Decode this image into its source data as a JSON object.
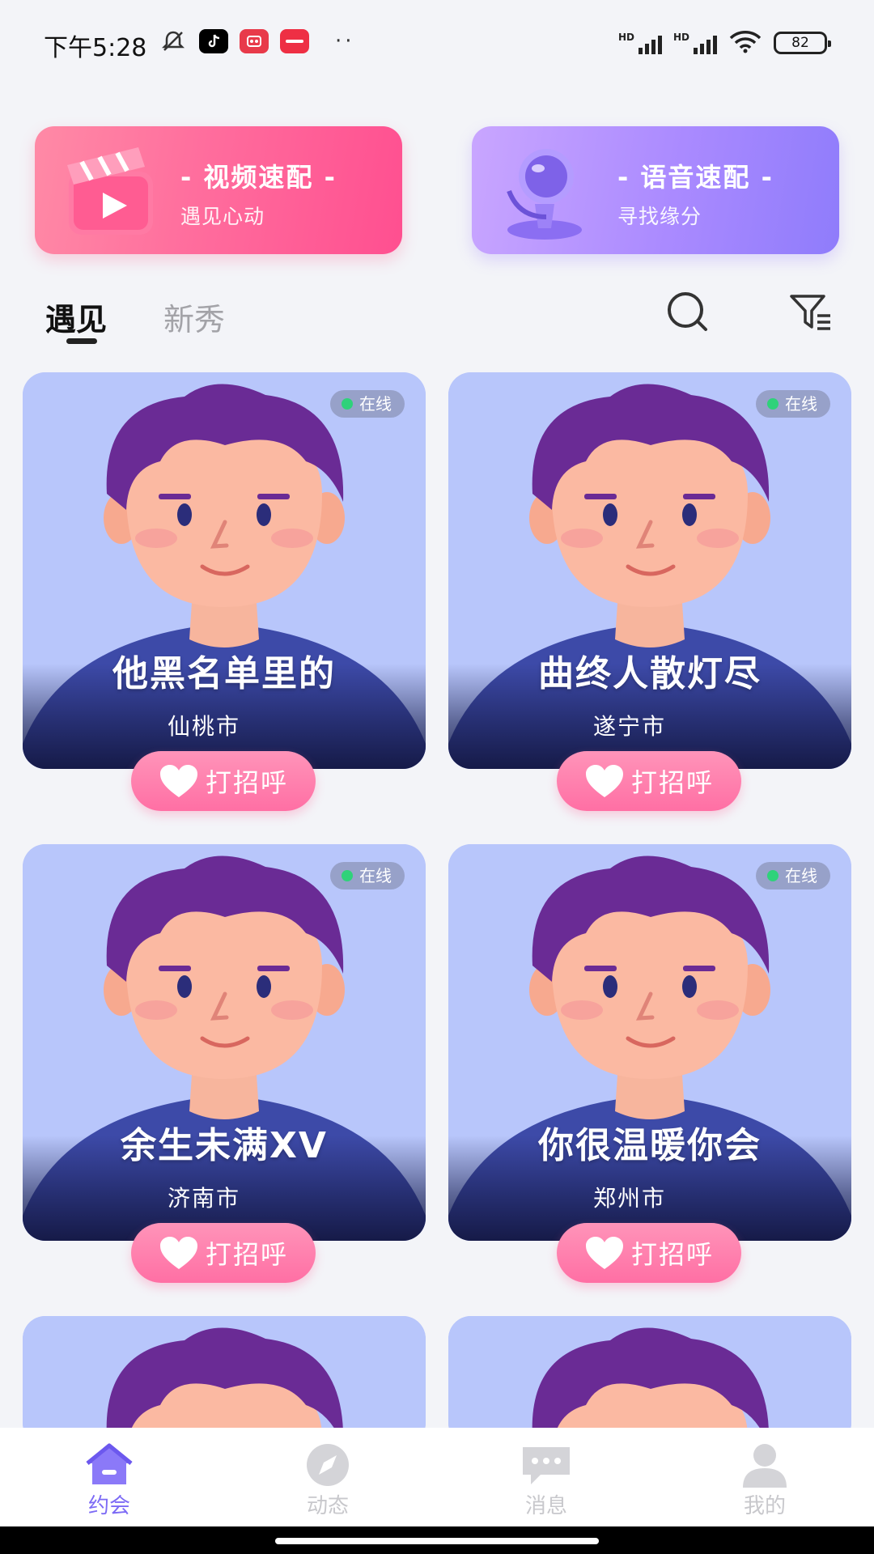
{
  "status_bar": {
    "time": "下午5:28",
    "battery": "82",
    "signal_label_1": "HD",
    "signal_label_2": "HD",
    "more_dots": "··"
  },
  "banners": {
    "video": {
      "title": "- 视频速配 -",
      "subtitle": "遇见心动"
    },
    "voice": {
      "title": "- 语音速配 -",
      "subtitle": "寻找缘分"
    }
  },
  "tabs": [
    {
      "label": "遇见",
      "active": true
    },
    {
      "label": "新秀",
      "active": false
    }
  ],
  "cards": [
    {
      "name": "他黑名单里的",
      "city": "仙桃市",
      "status": "在线",
      "greet": "打招呼"
    },
    {
      "name": "曲终人散灯尽",
      "city": "遂宁市",
      "status": "在线",
      "greet": "打招呼"
    },
    {
      "name": "余生未满XV",
      "city": "济南市",
      "status": "在线",
      "greet": "打招呼"
    },
    {
      "name": "你很温暖你会",
      "city": "郑州市",
      "status": "在线",
      "greet": "打招呼"
    }
  ],
  "bottom_nav": [
    {
      "label": "约会",
      "icon": "home-icon",
      "active": true
    },
    {
      "label": "动态",
      "icon": "compass-icon",
      "active": false
    },
    {
      "label": "消息",
      "icon": "message-icon",
      "active": false
    },
    {
      "label": "我的",
      "icon": "person-icon",
      "active": false
    }
  ],
  "colors": {
    "accent_purple": "#7c6af5",
    "pink_button": "#ff6fa4",
    "video_banner": "#ff5f96",
    "voice_banner": "#a98bff",
    "online_dot": "#2fd27a"
  }
}
